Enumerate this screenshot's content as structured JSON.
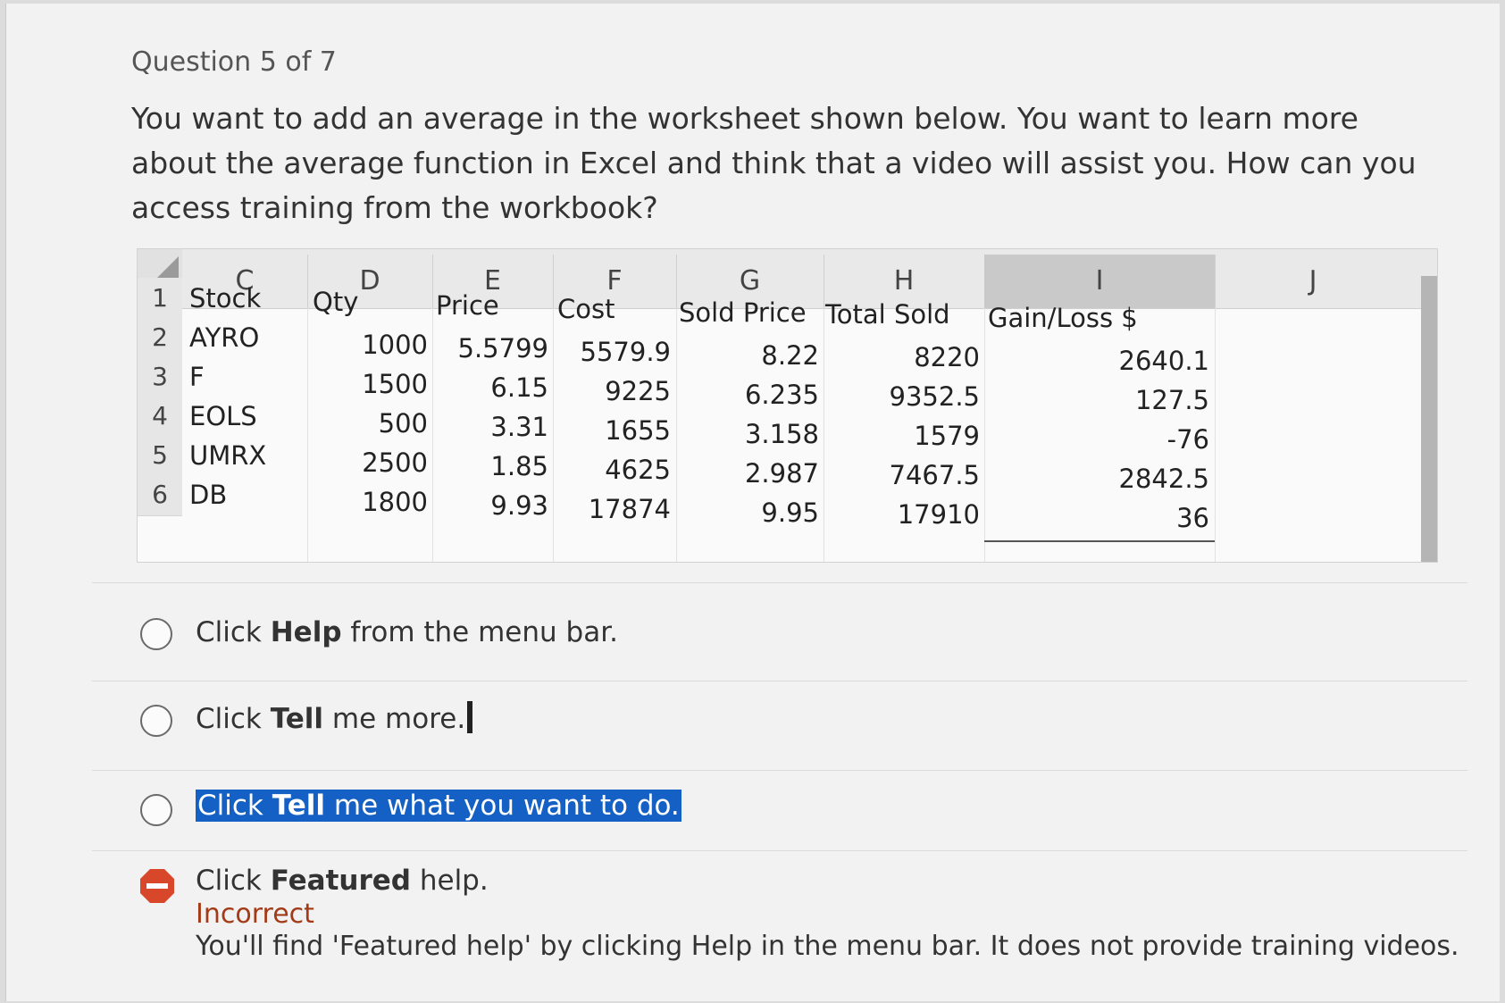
{
  "question": {
    "counter": "Question 5 of 7",
    "prompt": "You want to add an average in the worksheet shown below. You want to learn more about the average function in Excel and think that a video will assist you. How can you access training from the workbook?"
  },
  "sheet": {
    "columns": [
      "C",
      "D",
      "E",
      "F",
      "G",
      "H",
      "I",
      "J"
    ],
    "row_numbers": [
      "1",
      "2",
      "3",
      "4",
      "5",
      "6"
    ],
    "headers": [
      "Stock",
      "Qty",
      "Price",
      "Cost",
      "Sold Price",
      "Total Sold",
      "Gain/Loss $"
    ],
    "rows": [
      [
        "AYRO",
        "1000",
        "5.5799",
        "5579.9",
        "8.22",
        "8220",
        "2640.1"
      ],
      [
        "F",
        "1500",
        "6.15",
        "9225",
        "6.235",
        "9352.5",
        "127.5"
      ],
      [
        "EOLS",
        "500",
        "3.31",
        "1655",
        "3.158",
        "1579",
        "-76"
      ],
      [
        "UMRX",
        "2500",
        "1.85",
        "4625",
        "2.987",
        "7467.5",
        "2842.5"
      ],
      [
        "DB",
        "1800",
        "9.93",
        "17874",
        "9.95",
        "17910",
        "36"
      ]
    ]
  },
  "options": [
    {
      "pre": "Click ",
      "bold": "Help",
      "post": " from the menu bar."
    },
    {
      "pre": "Click ",
      "bold": "Tell",
      "post": " me more."
    },
    {
      "pre": "Click ",
      "bold": "Tell",
      "post": " me what you want to do."
    },
    {
      "pre": "Click ",
      "bold": "Featured",
      "post": " help."
    }
  ],
  "result": {
    "status": "Incorrect",
    "feedback": "You'll find 'Featured help' by clicking Help in the menu bar. It does not provide training videos."
  },
  "colors": {
    "highlight": "#1460c4",
    "incorrect": "#a33b17",
    "stop_icon": "#d9472b"
  }
}
